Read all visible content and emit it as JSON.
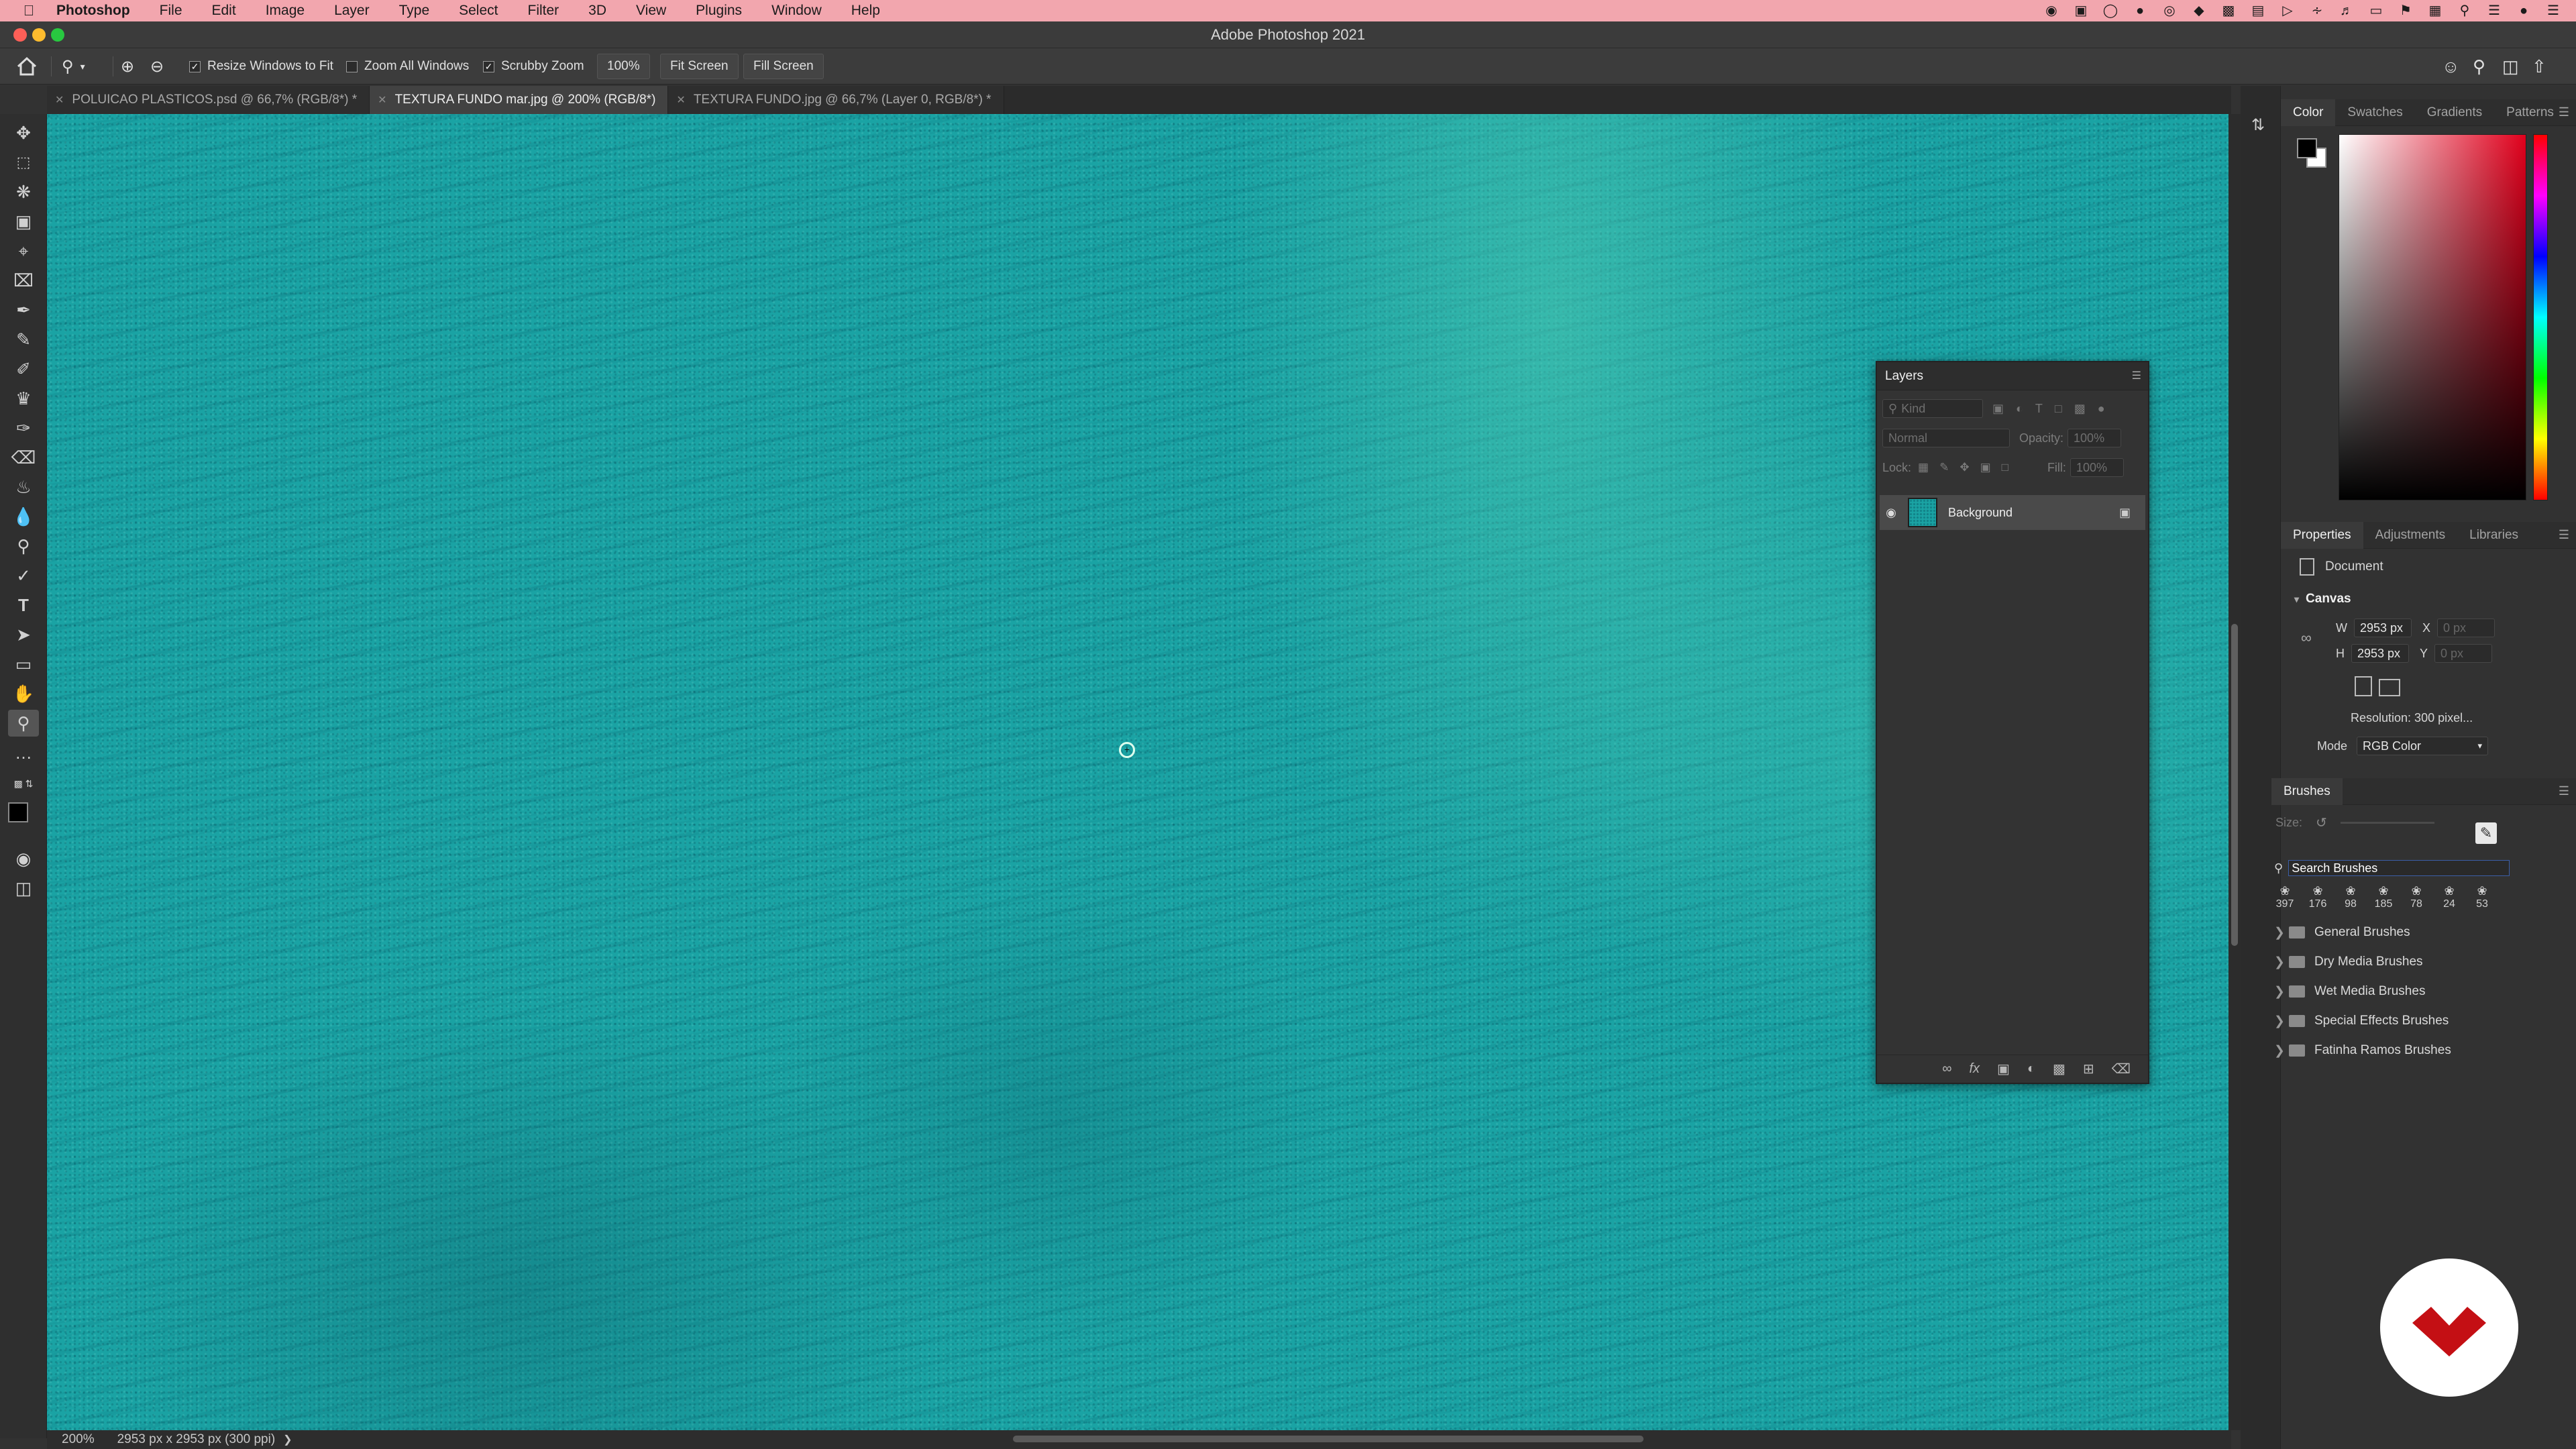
{
  "menubar": {
    "app": "Photoshop",
    "items": [
      "File",
      "Edit",
      "Image",
      "Layer",
      "Type",
      "Select",
      "Filter",
      "3D",
      "View",
      "Plugins",
      "Window",
      "Help"
    ]
  },
  "window": {
    "title": "Adobe Photoshop 2021"
  },
  "options": {
    "resize_windows": "Resize Windows to Fit",
    "zoom_all": "Zoom All Windows",
    "scrubby": "Scrubby Zoom",
    "zoom_value": "100%",
    "fit_screen": "Fit Screen",
    "fill_screen": "Fill Screen",
    "resize_checked": true,
    "zoom_all_checked": false,
    "scrubby_checked": true
  },
  "tabs": [
    {
      "label": "POLUICAO PLASTICOS.psd @ 66,7% (RGB/8*) *",
      "active": false
    },
    {
      "label": "TEXTURA FUNDO mar.jpg @ 200% (RGB/8*)",
      "active": true
    },
    {
      "label": "TEXTURA FUNDO.jpg @ 66,7% (Layer 0, RGB/8*) *",
      "active": false
    }
  ],
  "status": {
    "zoom": "200%",
    "doc_info": "2953 px x 2953 px (300 ppi)"
  },
  "color_panel": {
    "tabs": [
      "Color",
      "Swatches",
      "Gradients",
      "Patterns"
    ],
    "foreground": "#000000",
    "background": "#ffffff",
    "hue": "#e0001c"
  },
  "properties": {
    "tabs": [
      "Properties",
      "Adjustments",
      "Libraries"
    ],
    "document": "Document",
    "section": "Canvas",
    "w_label": "W",
    "w_value": "2953 px",
    "h_label": "H",
    "h_value": "2953 px",
    "x_label": "X",
    "x_placeholder": "0 px",
    "y_label": "Y",
    "y_placeholder": "0 px",
    "resolution": "Resolution: 300 pixel...",
    "mode_label": "Mode",
    "mode_value": "RGB Color"
  },
  "brushes": {
    "title": "Brushes",
    "size_label": "Size:",
    "search_placeholder": "Search Brushes",
    "recent": [
      "397",
      "176",
      "98",
      "185",
      "78",
      "24",
      "53"
    ],
    "groups": [
      "General Brushes",
      "Dry Media Brushes",
      "Wet Media Brushes",
      "Special Effects Brushes",
      "Fatinha Ramos Brushes"
    ]
  },
  "layers": {
    "title": "Layers",
    "kind_placeholder": "Kind",
    "blend": "Normal",
    "opacity_label": "Opacity:",
    "opacity_value": "100%",
    "lock_label": "Lock:",
    "fill_label": "Fill:",
    "fill_value": "100%",
    "items": [
      {
        "name": "Background",
        "visible": true,
        "locked": true
      }
    ]
  }
}
